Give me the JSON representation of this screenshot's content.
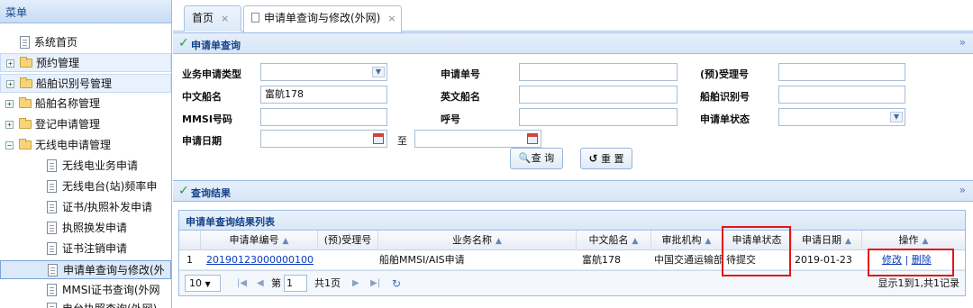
{
  "sidebar": {
    "title": "菜单",
    "items": [
      {
        "label": "系统首页",
        "type": "doc"
      },
      {
        "label": "预约管理",
        "type": "folder",
        "toggle": "+"
      },
      {
        "label": "船舶识别号管理",
        "type": "folder",
        "toggle": "+"
      },
      {
        "label": "船舶名称管理",
        "type": "folder",
        "toggle": "+"
      },
      {
        "label": "登记申请管理",
        "type": "folder",
        "toggle": "+"
      },
      {
        "label": "无线电申请管理",
        "type": "folder",
        "toggle": "−"
      },
      {
        "label": "无线电业务申请",
        "type": "doc"
      },
      {
        "label": "无线电台(站)频率申",
        "type": "doc"
      },
      {
        "label": "证书/执照补发申请",
        "type": "doc"
      },
      {
        "label": "执照换发申请",
        "type": "doc"
      },
      {
        "label": "证书注销申请",
        "type": "doc"
      },
      {
        "label": "申请单查询与修改(外",
        "type": "doc"
      },
      {
        "label": "MMSI证书查询(外网",
        "type": "doc"
      },
      {
        "label": "电台执照查询(外网)",
        "type": "doc"
      }
    ]
  },
  "tabs": {
    "home": "首页",
    "active": "申请单查询与修改(外网)",
    "close": "×"
  },
  "query_panel": {
    "title": "申请单查询",
    "labels": {
      "app_type": "业务申请类型",
      "app_no": "申请单号",
      "accept_no": "(预)受理号",
      "ship_cn": "中文船名",
      "ship_en": "英文船名",
      "ship_id": "船舶识别号",
      "mmsi": "MMSI号码",
      "callsign": "呼号",
      "status": "申请单状态",
      "date": "申请日期",
      "to": "至"
    },
    "values": {
      "ship_cn": "富航178"
    },
    "buttons": {
      "search": "查 询",
      "reset": "重 置"
    }
  },
  "result_panel": {
    "title": "查询结果",
    "grid_title": "申请单查询结果列表",
    "columns": [
      "申请单编号",
      "(预)受理号",
      "业务名称",
      "中文船名",
      "审批机构",
      "申请单状态",
      "申请日期",
      "操作"
    ],
    "rows": [
      {
        "index": "1",
        "app_no": "20190123000000100",
        "accept_no": "",
        "business": "船舶MMSI/AIS申请",
        "ship_cn": "富航178",
        "org": "中国交通运输部",
        "status": "待提交",
        "date": "2019-01-23",
        "edit": "修改",
        "sep": "|",
        "delete": "删除"
      }
    ],
    "pager": {
      "page_size": "10",
      "page_label_pre": "第",
      "page_value": "1",
      "page_label_post": "共1页",
      "summary": "显示1到1,共1记录"
    }
  },
  "colors": {
    "header_text": "#15428b",
    "border": "#99bbe8",
    "highlight": "#e0161a",
    "link": "#0b3bbd"
  }
}
